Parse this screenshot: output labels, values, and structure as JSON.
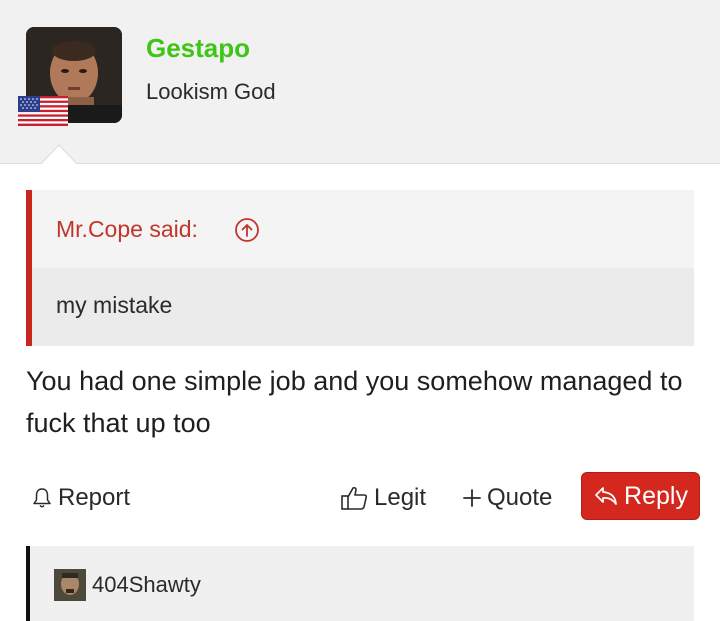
{
  "post": {
    "author": {
      "name": "Gestapo",
      "title": "Lookism God",
      "name_color": "#3ec515",
      "flag": "us-flag-icon"
    },
    "quote": {
      "author_label": "Mr.Cope said:",
      "text": "my mistake",
      "accent_color": "#c8261e"
    },
    "message": "You had one simple job and you somehow managed to fuck that up too",
    "actions": {
      "report_label": "Report",
      "legit_label": "Legit",
      "quote_label": "Quote",
      "reply_label": "Reply",
      "reply_color": "#d4281e"
    }
  },
  "next_quote": {
    "user": "404Shawty"
  }
}
